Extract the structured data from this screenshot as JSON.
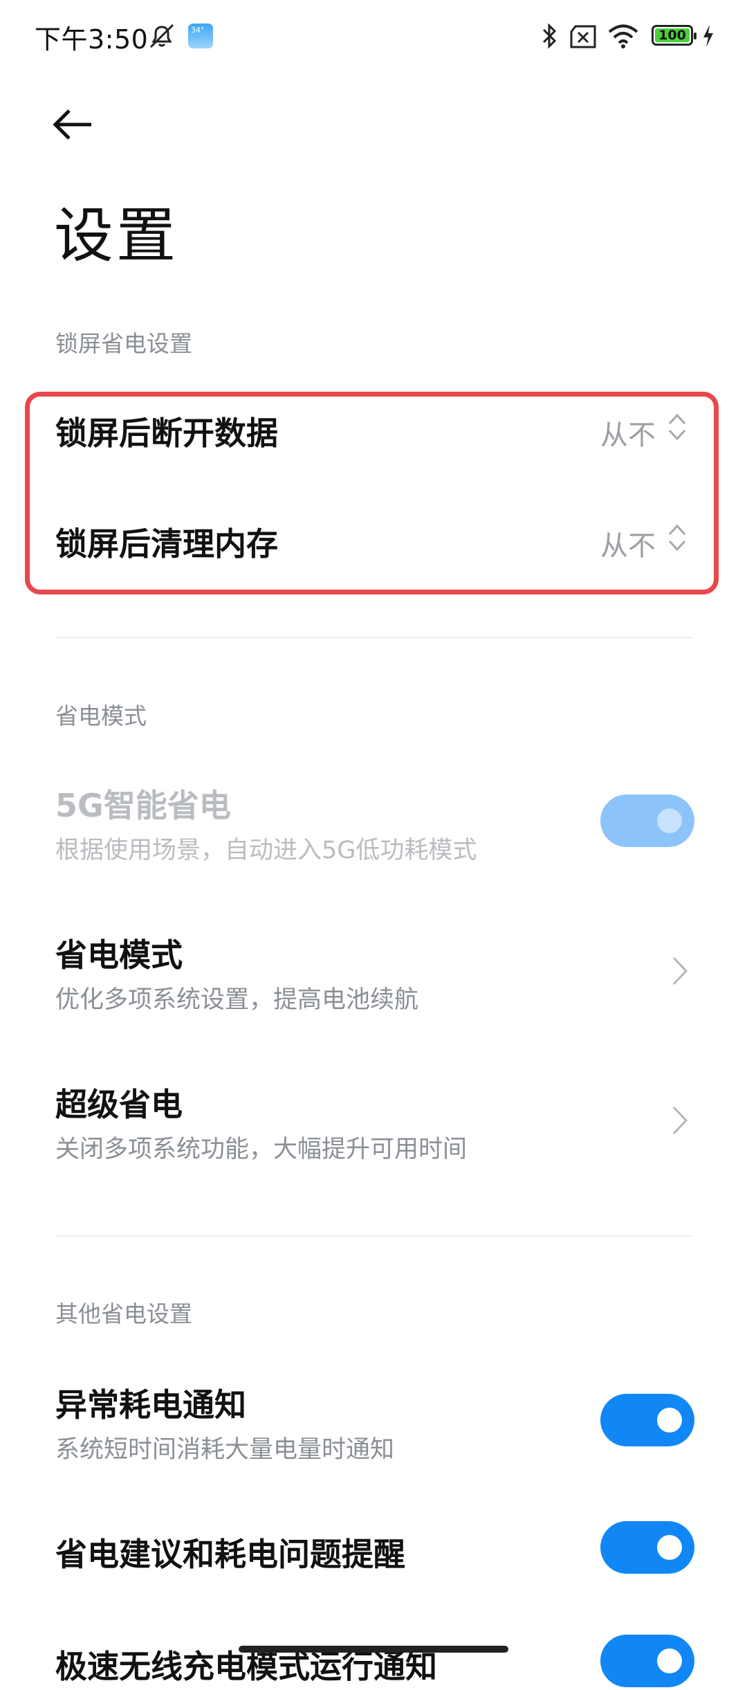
{
  "status_bar": {
    "time": "下午3:50",
    "weather_badge": "34°",
    "battery": "100",
    "icons": [
      "mute-icon",
      "weather-icon",
      "bluetooth-icon",
      "sim-no-signal-icon",
      "wifi-icon",
      "battery-icon",
      "charging-icon"
    ]
  },
  "header": {
    "back_icon": "back-arrow-icon",
    "title": "设置"
  },
  "sections": {
    "lock": {
      "title": "锁屏省电设置",
      "items": [
        {
          "label": "锁屏后断开数据",
          "value": "从不"
        },
        {
          "label": "锁屏后清理内存",
          "value": "从不"
        }
      ]
    },
    "saver": {
      "title": "省电模式",
      "items": [
        {
          "label": "5G智能省电",
          "desc": "根据使用场景，自动进入5G低功耗模式",
          "toggle_on": true,
          "disabled": true
        },
        {
          "label": "省电模式",
          "desc": "优化多项系统设置，提高电池续航"
        },
        {
          "label": "超级省电",
          "desc": "关闭多项系统功能，大幅提升可用时间"
        }
      ]
    },
    "other": {
      "title": "其他省电设置",
      "items": [
        {
          "label": "异常耗电通知",
          "desc": "系统短时间消耗大量电量时通知",
          "toggle_on": true
        },
        {
          "label": "省电建议和耗电问题提醒",
          "toggle_on": true
        },
        {
          "label": "极速无线充电模式运行通知",
          "toggle_on": true
        }
      ]
    }
  },
  "colors": {
    "accent": "#1187f5",
    "highlight": "#e8474b",
    "muted": "#8a8f96"
  }
}
